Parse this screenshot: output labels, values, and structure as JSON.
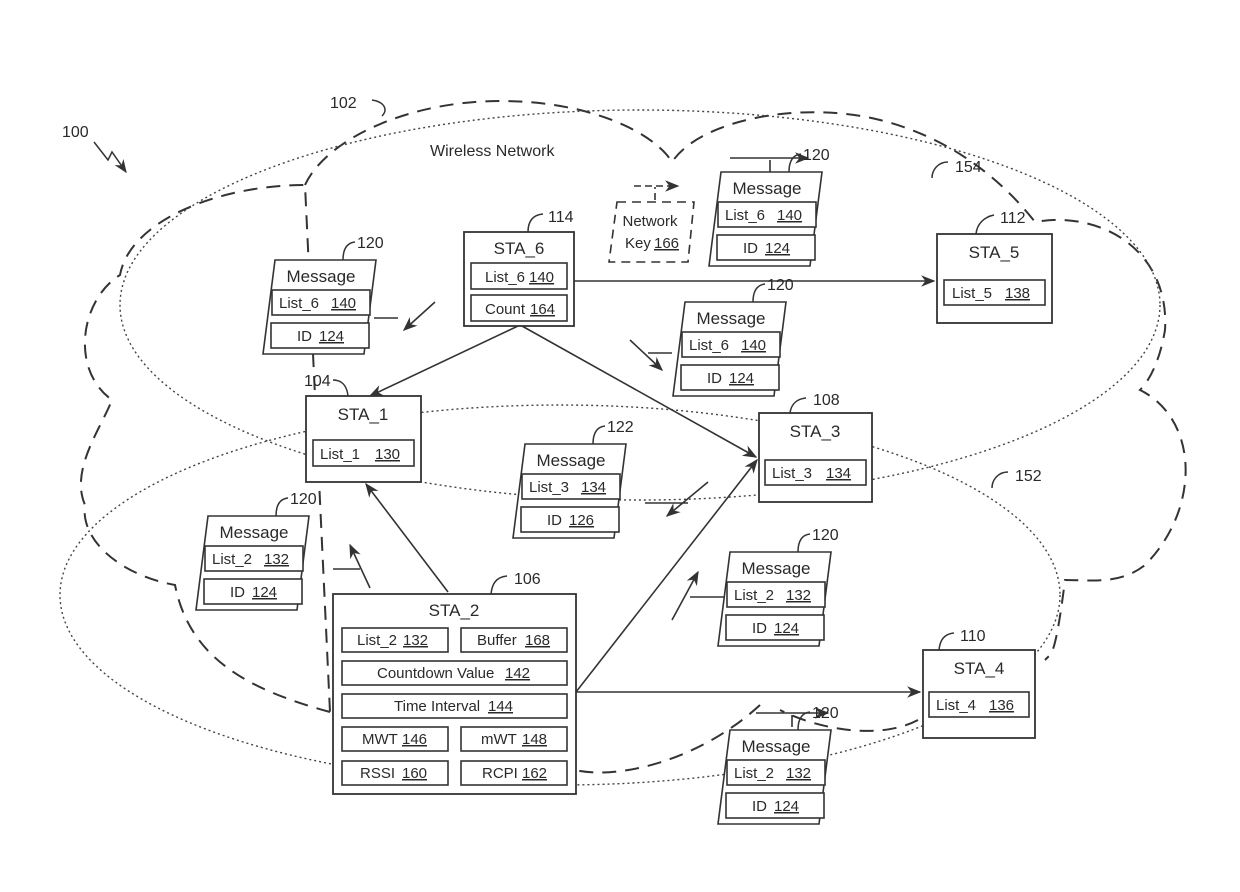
{
  "figure": {
    "ref_system": "100",
    "ref_network": "102",
    "network_label": "Wireless Network",
    "ref_bss_1": "152",
    "ref_bss_2": "154"
  },
  "stations": {
    "sta6": {
      "title": "STA_6",
      "ref": "114",
      "fields": [
        {
          "label": "List_6",
          "num": "140"
        },
        {
          "label": "Count",
          "num": "164"
        }
      ]
    },
    "sta5": {
      "title": "STA_5",
      "ref": "112",
      "fields": [
        {
          "label": "List_5",
          "num": "138"
        }
      ]
    },
    "sta1": {
      "title": "STA_1",
      "ref": "104",
      "fields": [
        {
          "label": "List_1",
          "num": "130"
        }
      ]
    },
    "sta3": {
      "title": "STA_3",
      "ref": "108",
      "fields": [
        {
          "label": "List_3",
          "num": "134"
        }
      ]
    },
    "sta4": {
      "title": "STA_4",
      "ref": "110",
      "fields": [
        {
          "label": "List_4",
          "num": "136"
        }
      ]
    },
    "sta2": {
      "title": "STA_2",
      "ref": "106",
      "fields": [
        {
          "label": "List_2",
          "num": "132"
        },
        {
          "label": "Buffer",
          "num": "168"
        },
        {
          "label": "Countdown Value",
          "num": "142"
        },
        {
          "label": "Time Interval",
          "num": "144"
        },
        {
          "label": "MWT",
          "num": "146"
        },
        {
          "label": "mWT",
          "num": "148"
        },
        {
          "label": "RSSI",
          "num": "160"
        },
        {
          "label": "RCPI",
          "num": "162"
        }
      ]
    }
  },
  "network_key": {
    "line1": "Network",
    "line2": "Key",
    "num": "166"
  },
  "messages": [
    {
      "title": "Message",
      "ref": "120",
      "list": "List_6",
      "list_num": "140",
      "id": "ID",
      "id_num": "124"
    },
    {
      "title": "Message",
      "ref": "120",
      "list": "List_6",
      "list_num": "140",
      "id": "ID",
      "id_num": "124"
    },
    {
      "title": "Message",
      "ref": "120",
      "list": "List_6",
      "list_num": "140",
      "id": "ID",
      "id_num": "124"
    },
    {
      "title": "Message",
      "ref": "122",
      "list": "List_3",
      "list_num": "134",
      "id": "ID",
      "id_num": "126"
    },
    {
      "title": "Message",
      "ref": "120",
      "list": "List_2",
      "list_num": "132",
      "id": "ID",
      "id_num": "124"
    },
    {
      "title": "Message",
      "ref": "120",
      "list": "List_2",
      "list_num": "132",
      "id": "ID",
      "id_num": "124"
    },
    {
      "title": "Message",
      "ref": "120",
      "list": "List_2",
      "list_num": "132",
      "id": "ID",
      "id_num": "124"
    }
  ]
}
